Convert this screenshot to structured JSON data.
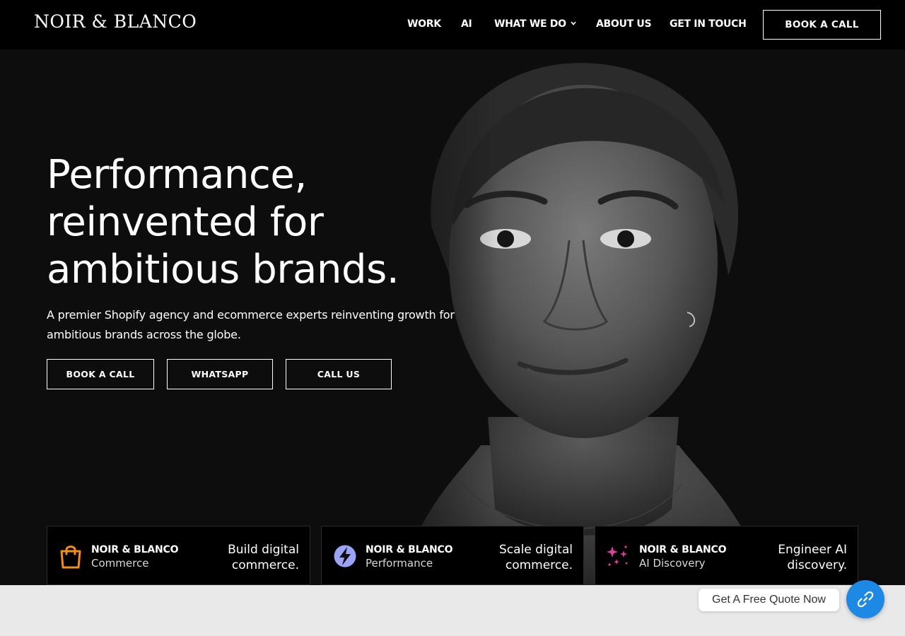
{
  "header": {
    "logo": "NOIR & BLANCO",
    "nav": [
      {
        "label": "WORK"
      },
      {
        "label": "AI"
      },
      {
        "label": "WHAT WE DO"
      },
      {
        "label": "ABOUT US"
      },
      {
        "label": "GET IN TOUCH"
      }
    ],
    "book_label": "BOOK A CALL"
  },
  "hero": {
    "headline": [
      "Performance,",
      "reinvented for",
      "ambitious brands."
    ],
    "subtitle": "A premier Shopify agency and ecommerce experts reinventing growth for ambitious brands across the globe.",
    "ctas": [
      "BOOK A CALL",
      "WHATSAPP",
      "CALL US"
    ]
  },
  "cards": [
    {
      "brand": "NOIR & BLANCO",
      "kind": "Commerce",
      "tagline": "Build digital commerce.",
      "icon": "shopping-bag-icon",
      "color": "#f28c1b"
    },
    {
      "brand": "NOIR & BLANCO",
      "kind": "Performance",
      "tagline": "Scale digital commerce.",
      "icon": "lightning-bolt-icon",
      "color": "#9aa3f5"
    },
    {
      "brand": "NOIR & BLANCO",
      "kind": "AI Discovery",
      "tagline": "Engineer AI discovery.",
      "icon": "sparkles-icon",
      "color": "#e0409a"
    }
  ],
  "quote": {
    "label": "Get A Free Quote Now",
    "icon": "link-icon",
    "color": "#1e88e5"
  }
}
